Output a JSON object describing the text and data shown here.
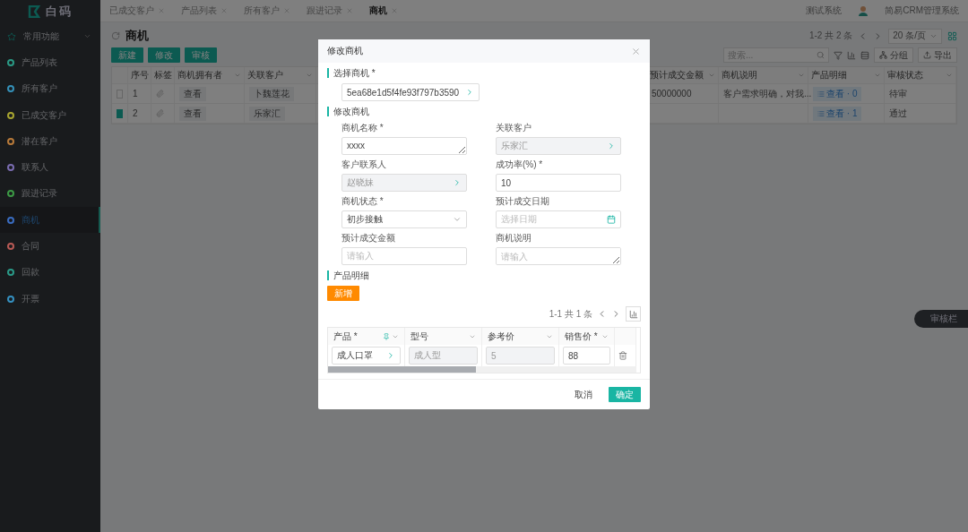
{
  "sidebar": {
    "logo": "白码",
    "group": {
      "label": "常用功能",
      "expanded": true
    },
    "items": [
      {
        "label": "产品列表",
        "color": "#2a9a85",
        "selected": false
      },
      {
        "label": "所有客户",
        "color": "#3590b8",
        "selected": false
      },
      {
        "label": "已成交客户",
        "color": "#a8a530",
        "selected": false
      },
      {
        "label": "潜在客户",
        "color": "#b87a3a",
        "selected": false
      },
      {
        "label": "联系人",
        "color": "#7a6cb0",
        "selected": false
      },
      {
        "label": "跟进记录",
        "color": "#3c9a45",
        "selected": false
      },
      {
        "label": "商机",
        "color": "#3a6cc0",
        "selected": true
      },
      {
        "label": "合同",
        "color": "#b85a55",
        "selected": false
      },
      {
        "label": "回款",
        "color": "#2a9a88",
        "selected": false
      },
      {
        "label": "开票",
        "color": "#3590c0",
        "selected": false
      }
    ]
  },
  "tabs": [
    {
      "label": "已成交客户",
      "selected": false
    },
    {
      "label": "产品列表",
      "selected": false
    },
    {
      "label": "所有客户",
      "selected": false
    },
    {
      "label": "跟进记录",
      "selected": false
    },
    {
      "label": "商机",
      "selected": true
    }
  ],
  "header": {
    "system": "测试系统",
    "user": "简易CRM管理系统"
  },
  "page": {
    "title": "商机",
    "actions": [
      "新建",
      "修改",
      "审核"
    ],
    "summary": "1-2 共 2 条",
    "page_size": "20 条/页",
    "search_placeholder": "搜索...",
    "tools": [
      "分组",
      "导出"
    ]
  },
  "table": {
    "index_heading": "序号",
    "tag_heading": "标签",
    "columns_left": [
      "商机拥有者",
      "关联客户"
    ],
    "columns_right": [
      "预计成交金额",
      "商机说明",
      "产品明细",
      "审核状态"
    ],
    "rows": [
      {
        "checked": false,
        "number": "1",
        "owner": "查看",
        "customer": "卜魏莲花",
        "amount": "50000000",
        "note": "客户需求明确，对我...",
        "products": "查看 · 0",
        "status": "待审"
      },
      {
        "checked": true,
        "number": "2",
        "owner": "查看",
        "customer": "乐家汇",
        "amount": "",
        "note": "",
        "products": "查看 · 1",
        "status": "通过"
      }
    ]
  },
  "side_button": "审核栏",
  "dialog": {
    "title": "修改商机",
    "picker_title": "选择商机 *",
    "picker_value": "5ea68e1d5f4fe93f797b3590",
    "form_title": "修改商机",
    "fields": [
      {
        "kind": "textarea",
        "label": "商机名称 *",
        "value": "xxxx",
        "disabled": false
      },
      {
        "kind": "lookup",
        "label": "关联客户",
        "value": "乐家汇",
        "disabled": true
      },
      {
        "kind": "lookup",
        "label": "客户联系人",
        "value": "赵晓妹",
        "disabled": true
      },
      {
        "kind": "text",
        "label": "成功率(%) *",
        "value": "10",
        "disabled": false
      },
      {
        "kind": "select",
        "label": "商机状态 *",
        "value": "初步接触",
        "disabled": false
      },
      {
        "kind": "date",
        "label": "预计成交日期",
        "placeholder": "选择日期",
        "disabled": false
      },
      {
        "kind": "text",
        "label": "预计成交金额",
        "placeholder": "请输入",
        "disabled": false
      },
      {
        "kind": "textarea",
        "label": "商机说明",
        "placeholder": "请输入",
        "disabled": false
      }
    ],
    "products": {
      "title": "产品明细",
      "add": "新增",
      "summary": "1-1 共 1 条",
      "columns": [
        "产品 *",
        "型号",
        "参考价",
        "销售价 *"
      ],
      "rows": [
        {
          "cells": [
            {
              "kind": "lookup",
              "value": "成人口罩",
              "disabled": false
            },
            {
              "kind": "text",
              "value": "成人型",
              "disabled": true
            },
            {
              "kind": "text",
              "value": "5",
              "disabled": true
            },
            {
              "kind": "text",
              "value": "88",
              "disabled": false
            }
          ]
        }
      ]
    },
    "cancel": "取消",
    "ok": "确定"
  }
}
